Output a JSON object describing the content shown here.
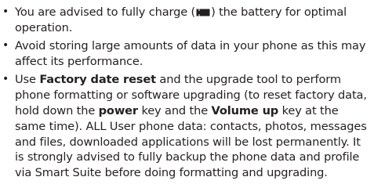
{
  "bullets": [
    {
      "pre": "You are advised to fully charge (",
      "icon": "battery-full-icon",
      "post": ") the battery for optimal operation."
    },
    {
      "text": "Avoid storing large amounts of data in your phone as this may affect its performance."
    },
    {
      "p1": "Use ",
      "b1": "Factory date reset",
      "p2": " and the upgrade tool to perform phone formatting or software upgrading (to reset factory data, hold down the ",
      "b2": "power",
      "p3": " key and the ",
      "b3": "Volume up",
      "p4": " key at the same time). ALL User phone data: contacts, photos, messages and files, downloaded applications will be lost permanently. It is strongly advised to fully backup the phone data and profile via Smart Suite before doing formatting and upgrading."
    }
  ]
}
